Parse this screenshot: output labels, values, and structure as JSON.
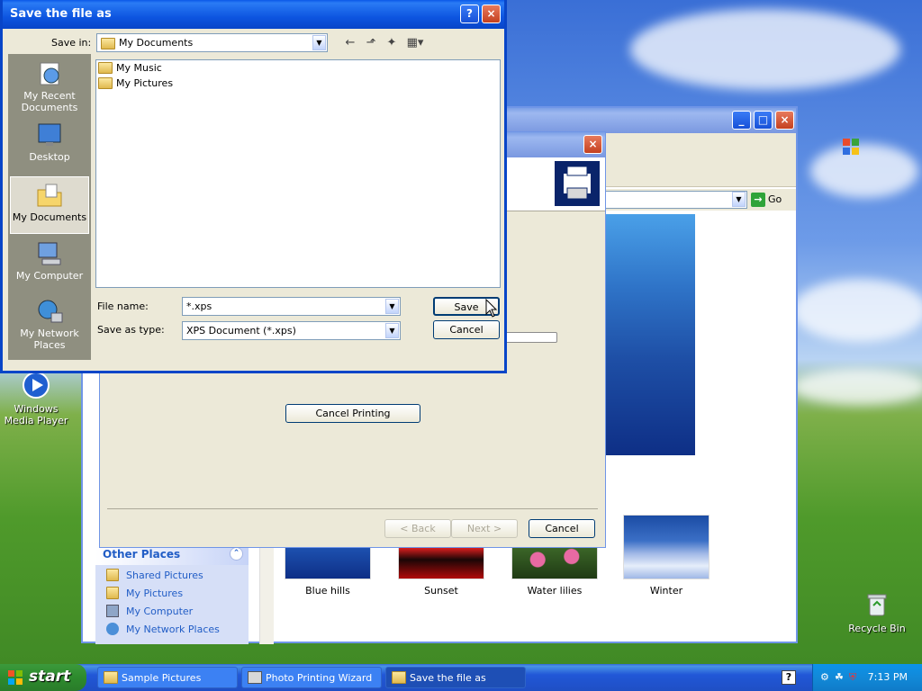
{
  "desktop": {
    "icons": {
      "wmp": "Windows Media Player",
      "recycle": "Recycle Bin"
    }
  },
  "explorer": {
    "go_label": "Go",
    "other_places": {
      "heading": "Other Places",
      "links": [
        "Shared Pictures",
        "My Pictures",
        "My Computer",
        "My Network Places"
      ]
    },
    "thumbnails": [
      "Blue hills",
      "Sunset",
      "Water lilies",
      "Winter"
    ]
  },
  "wizard": {
    "cancel_printing": "Cancel Printing",
    "back": "< Back",
    "next": "Next >",
    "cancel": "Cancel"
  },
  "save_dialog": {
    "title": "Save the file as",
    "save_in_label": "Save in:",
    "save_in_value": "My Documents",
    "places": [
      "My Recent Documents",
      "Desktop",
      "My Documents",
      "My Computer",
      "My Network Places"
    ],
    "items": [
      "My Music",
      "My Pictures"
    ],
    "file_name_label": "File name:",
    "file_name_value": "*.xps",
    "save_as_type_label": "Save as type:",
    "save_as_type_value": "XPS Document (*.xps)",
    "save_button": "Save",
    "cancel_button": "Cancel"
  },
  "taskbar": {
    "start": "start",
    "tasks": [
      "Sample Pictures",
      "Photo Printing Wizard",
      "Save the file as"
    ],
    "clock": "7:13 PM"
  }
}
